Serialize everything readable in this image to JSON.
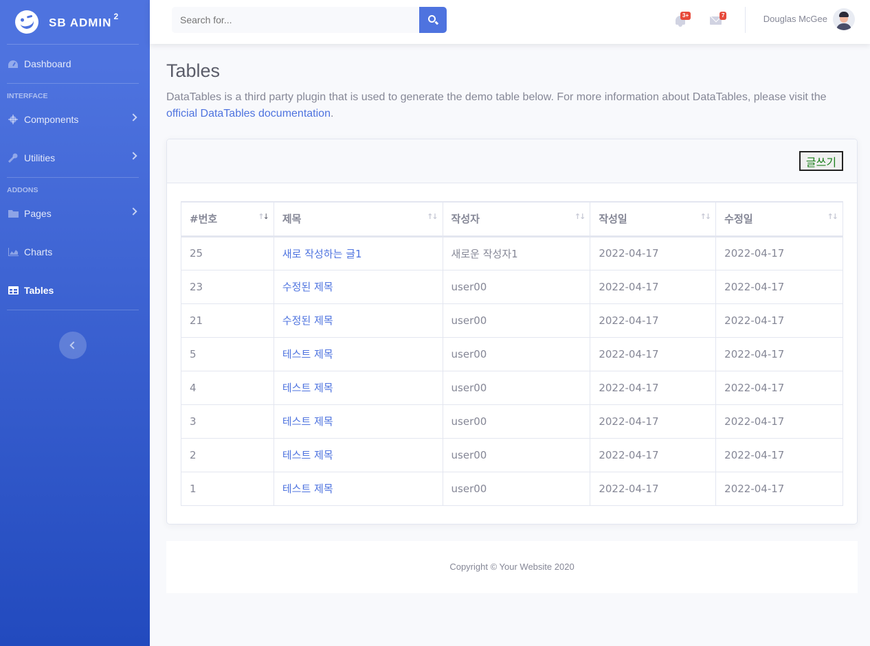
{
  "brand": {
    "name": "SB ADMIN",
    "sup": "2"
  },
  "sidebar": {
    "items": [
      {
        "label": "Dashboard",
        "icon": "tachometer-icon"
      },
      {
        "label": "Components",
        "icon": "cog-icon"
      },
      {
        "label": "Utilities",
        "icon": "wrench-icon"
      },
      {
        "label": "Pages",
        "icon": "folder-icon"
      },
      {
        "label": "Charts",
        "icon": "chart-area-icon"
      },
      {
        "label": "Tables",
        "icon": "table-icon"
      }
    ],
    "headings": {
      "interface": "INTERFACE",
      "addons": "ADDONS"
    }
  },
  "topbar": {
    "search_placeholder": "Search for...",
    "alerts_badge": "3+",
    "messages_badge": "7",
    "user_name": "Douglas McGee"
  },
  "page": {
    "title": "Tables",
    "desc_text": "DataTables is a third party plugin that is used to generate the demo table below. For more information about DataTables, please visit the ",
    "desc_link": "official DataTables documentation",
    "desc_end": "."
  },
  "card": {
    "write_button": "글쓰기"
  },
  "table": {
    "headers": [
      "#번호",
      "제목",
      "작성자",
      "작성일",
      "수정일"
    ],
    "rows": [
      [
        "25",
        "새로 작성하는 글1",
        "새로운 작성자1",
        "2022-04-17",
        "2022-04-17"
      ],
      [
        "23",
        "수정된 제목",
        "user00",
        "2022-04-17",
        "2022-04-17"
      ],
      [
        "21",
        "수정된 제목",
        "user00",
        "2022-04-17",
        "2022-04-17"
      ],
      [
        "5",
        "테스트 제목",
        "user00",
        "2022-04-17",
        "2022-04-17"
      ],
      [
        "4",
        "테스트 제목",
        "user00",
        "2022-04-17",
        "2022-04-17"
      ],
      [
        "3",
        "테스트 제목",
        "user00",
        "2022-04-17",
        "2022-04-17"
      ],
      [
        "2",
        "테스트 제목",
        "user00",
        "2022-04-17",
        "2022-04-17"
      ],
      [
        "1",
        "테스트 제목",
        "user00",
        "2022-04-17",
        "2022-04-17"
      ]
    ]
  },
  "footer": {
    "copyright": "Copyright © Your Website 2020"
  },
  "colors": {
    "primary": "#4e73df",
    "danger": "#e74a3b",
    "text": "#858796"
  }
}
